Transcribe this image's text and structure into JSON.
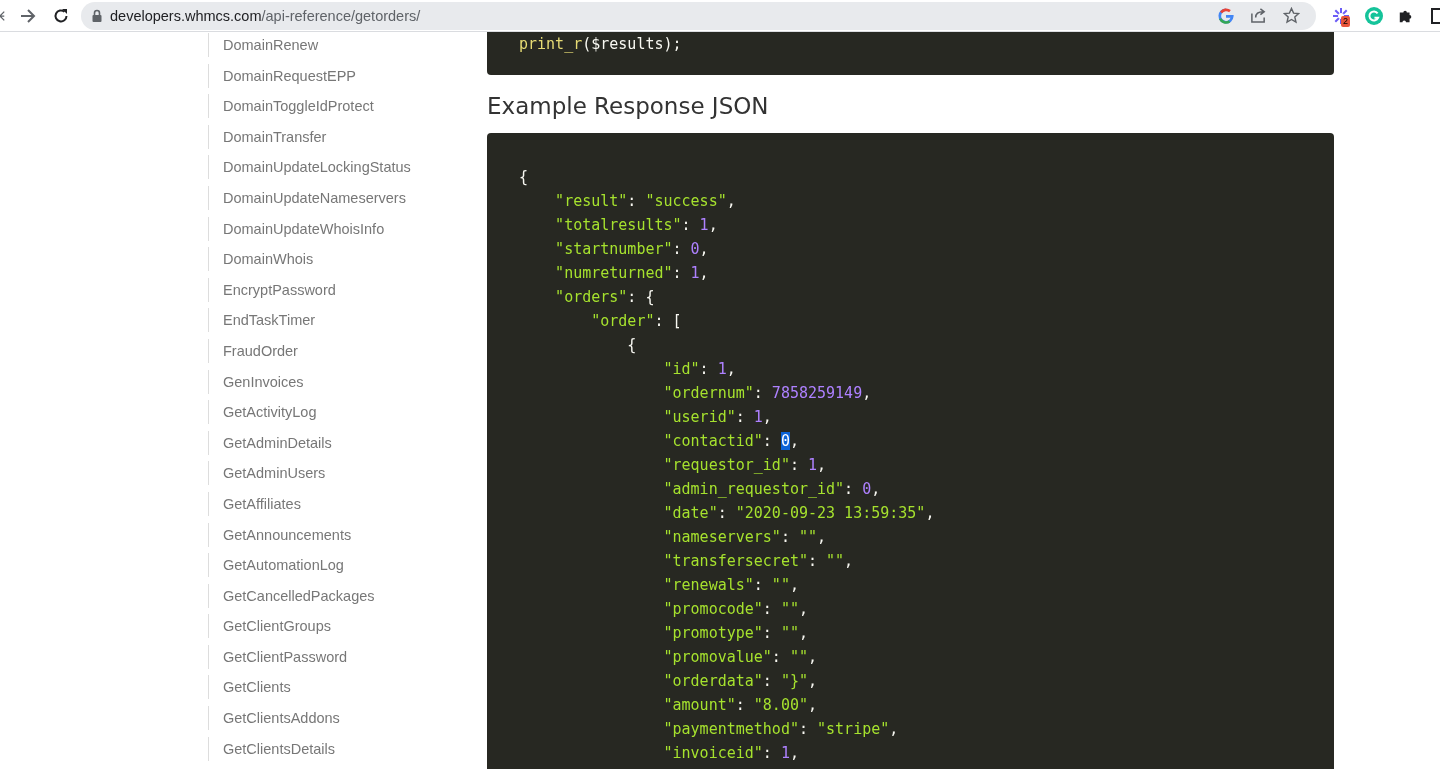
{
  "browser": {
    "url_host": "developers.whmcs.com",
    "url_path": "/api-reference/getorders/",
    "extension_badge": "2"
  },
  "sidebar": {
    "items": [
      {
        "label": "DomainRenew"
      },
      {
        "label": "DomainRequestEPP"
      },
      {
        "label": "DomainToggleIdProtect"
      },
      {
        "label": "DomainTransfer"
      },
      {
        "label": "DomainUpdateLockingStatus"
      },
      {
        "label": "DomainUpdateNameservers"
      },
      {
        "label": "DomainUpdateWhoisInfo"
      },
      {
        "label": "DomainWhois"
      },
      {
        "label": "EncryptPassword"
      },
      {
        "label": "EndTaskTimer"
      },
      {
        "label": "FraudOrder"
      },
      {
        "label": "GenInvoices"
      },
      {
        "label": "GetActivityLog"
      },
      {
        "label": "GetAdminDetails"
      },
      {
        "label": "GetAdminUsers"
      },
      {
        "label": "GetAffiliates"
      },
      {
        "label": "GetAnnouncements"
      },
      {
        "label": "GetAutomationLog"
      },
      {
        "label": "GetCancelledPackages"
      },
      {
        "label": "GetClientGroups"
      },
      {
        "label": "GetClientPassword"
      },
      {
        "label": "GetClients"
      },
      {
        "label": "GetClientsAddons"
      },
      {
        "label": "GetClientsDetails"
      }
    ]
  },
  "request_code": {
    "lines": [
      {
        "tokens": [
          {
            "kind": "function",
            "text": "print_r"
          },
          {
            "kind": "punct",
            "text": "($results);"
          }
        ]
      }
    ]
  },
  "response_heading": "Example Response JSON",
  "response_code": {
    "lines": [
      {
        "tokens": [
          {
            "kind": "punct",
            "text": "{"
          }
        ],
        "children": [
          {
            "tokens": [
              {
                "kind": "string",
                "text": "\"result\""
              },
              {
                "kind": "punct",
                "text": ":"
              },
              {
                "kind": "string",
                "text": "\"success\""
              },
              {
                "kind": "punct",
                "text": ","
              }
            ]
          },
          {
            "tokens": [
              {
                "kind": "string",
                "text": "\"totalresults\""
              },
              {
                "kind": "punct",
                "text": ":"
              },
              {
                "kind": "number",
                "text": "1"
              },
              {
                "kind": "punct",
                "text": ","
              }
            ]
          },
          {
            "tokens": [
              {
                "kind": "string",
                "text": "\"startnumber\""
              },
              {
                "kind": "punct",
                "text": ":"
              },
              {
                "kind": "number",
                "text": "0"
              },
              {
                "kind": "punct",
                "text": ","
              }
            ]
          },
          {
            "tokens": [
              {
                "kind": "string",
                "text": "\"numreturned\""
              },
              {
                "kind": "punct",
                "text": ":"
              },
              {
                "kind": "number",
                "text": "1"
              },
              {
                "kind": "punct",
                "text": ","
              }
            ]
          },
          {
            "tokens": [
              {
                "kind": "string",
                "text": "\"orders\""
              },
              {
                "kind": "punct",
                "text": ":"
              },
              {
                "kind": "punct",
                "text": "{"
              }
            ],
            "children": [
              {
                "tokens": [
                  {
                    "kind": "string",
                    "text": "\"order\""
                  },
                  {
                    "kind": "punct",
                    "text": ":"
                  },
                  {
                    "kind": "punct",
                    "text": "["
                  }
                ],
                "children": [
                  {
                    "tokens": [
                      {
                        "kind": "punct",
                        "text": "{"
                      }
                    ],
                    "children": [
                      {
                        "tokens": [
                          {
                            "kind": "string",
                            "text": "\"id\""
                          },
                          {
                            "kind": "punct",
                            "text": ":"
                          },
                          {
                            "kind": "number",
                            "text": "1"
                          },
                          {
                            "kind": "punct",
                            "text": ","
                          }
                        ]
                      },
                      {
                        "tokens": [
                          {
                            "kind": "string",
                            "text": "\"ordernum\""
                          },
                          {
                            "kind": "punct",
                            "text": ":"
                          },
                          {
                            "kind": "number",
                            "text": "7858259149"
                          },
                          {
                            "kind": "punct",
                            "text": ","
                          }
                        ]
                      },
                      {
                        "tokens": [
                          {
                            "kind": "string",
                            "text": "\"userid\""
                          },
                          {
                            "kind": "punct",
                            "text": ":"
                          },
                          {
                            "kind": "number",
                            "text": "1"
                          },
                          {
                            "kind": "punct",
                            "text": ","
                          }
                        ]
                      },
                      {
                        "tokens": [
                          {
                            "kind": "string",
                            "text": "\"contactid\""
                          },
                          {
                            "kind": "punct",
                            "text": ":"
                          },
                          {
                            "kind": "selection",
                            "text": "0"
                          },
                          {
                            "kind": "punct",
                            "text": ","
                          }
                        ]
                      },
                      {
                        "tokens": [
                          {
                            "kind": "string",
                            "text": "\"requestor_id\""
                          },
                          {
                            "kind": "punct",
                            "text": ":"
                          },
                          {
                            "kind": "number",
                            "text": "1"
                          },
                          {
                            "kind": "punct",
                            "text": ","
                          }
                        ]
                      },
                      {
                        "tokens": [
                          {
                            "kind": "string",
                            "text": "\"admin_requestor_id\""
                          },
                          {
                            "kind": "punct",
                            "text": ":"
                          },
                          {
                            "kind": "number",
                            "text": "0"
                          },
                          {
                            "kind": "punct",
                            "text": ","
                          }
                        ]
                      },
                      {
                        "tokens": [
                          {
                            "kind": "string",
                            "text": "\"date\""
                          },
                          {
                            "kind": "punct",
                            "text": ":"
                          },
                          {
                            "kind": "string",
                            "text": "\"2020-09-23 13:59:35\""
                          },
                          {
                            "kind": "punct",
                            "text": ","
                          }
                        ]
                      },
                      {
                        "tokens": [
                          {
                            "kind": "string",
                            "text": "\"nameservers\""
                          },
                          {
                            "kind": "punct",
                            "text": ":"
                          },
                          {
                            "kind": "string",
                            "text": "\"\""
                          },
                          {
                            "kind": "punct",
                            "text": ","
                          }
                        ]
                      },
                      {
                        "tokens": [
                          {
                            "kind": "string",
                            "text": "\"transfersecret\""
                          },
                          {
                            "kind": "punct",
                            "text": ":"
                          },
                          {
                            "kind": "string",
                            "text": "\"\""
                          },
                          {
                            "kind": "punct",
                            "text": ","
                          }
                        ]
                      },
                      {
                        "tokens": [
                          {
                            "kind": "string",
                            "text": "\"renewals\""
                          },
                          {
                            "kind": "punct",
                            "text": ":"
                          },
                          {
                            "kind": "string",
                            "text": "\"\""
                          },
                          {
                            "kind": "punct",
                            "text": ","
                          }
                        ]
                      },
                      {
                        "tokens": [
                          {
                            "kind": "string",
                            "text": "\"promocode\""
                          },
                          {
                            "kind": "punct",
                            "text": ":"
                          },
                          {
                            "kind": "string",
                            "text": "\"\""
                          },
                          {
                            "kind": "punct",
                            "text": ","
                          }
                        ]
                      },
                      {
                        "tokens": [
                          {
                            "kind": "string",
                            "text": "\"promotype\""
                          },
                          {
                            "kind": "punct",
                            "text": ":"
                          },
                          {
                            "kind": "string",
                            "text": "\"\""
                          },
                          {
                            "kind": "punct",
                            "text": ","
                          }
                        ]
                      },
                      {
                        "tokens": [
                          {
                            "kind": "string",
                            "text": "\"promovalue\""
                          },
                          {
                            "kind": "punct",
                            "text": ":"
                          },
                          {
                            "kind": "string",
                            "text": "\"\""
                          },
                          {
                            "kind": "punct",
                            "text": ","
                          }
                        ]
                      },
                      {
                        "tokens": [
                          {
                            "kind": "string",
                            "text": "\"orderdata\""
                          },
                          {
                            "kind": "punct",
                            "text": ":"
                          },
                          {
                            "kind": "string",
                            "text": "\"}\""
                          },
                          {
                            "kind": "punct",
                            "text": ","
                          }
                        ]
                      },
                      {
                        "tokens": [
                          {
                            "kind": "string",
                            "text": "\"amount\""
                          },
                          {
                            "kind": "punct",
                            "text": ":"
                          },
                          {
                            "kind": "string",
                            "text": "\"8.00\""
                          },
                          {
                            "kind": "punct",
                            "text": ","
                          }
                        ]
                      },
                      {
                        "tokens": [
                          {
                            "kind": "string",
                            "text": "\"paymentmethod\""
                          },
                          {
                            "kind": "punct",
                            "text": ":"
                          },
                          {
                            "kind": "string",
                            "text": "\"stripe\""
                          },
                          {
                            "kind": "punct",
                            "text": ","
                          }
                        ]
                      },
                      {
                        "tokens": [
                          {
                            "kind": "string",
                            "text": "\"invoiceid\""
                          },
                          {
                            "kind": "punct",
                            "text": ":"
                          },
                          {
                            "kind": "number",
                            "text": "1"
                          },
                          {
                            "kind": "punct",
                            "text": ","
                          }
                        ]
                      }
                    ]
                  }
                ]
              }
            ]
          }
        ]
      }
    ]
  }
}
